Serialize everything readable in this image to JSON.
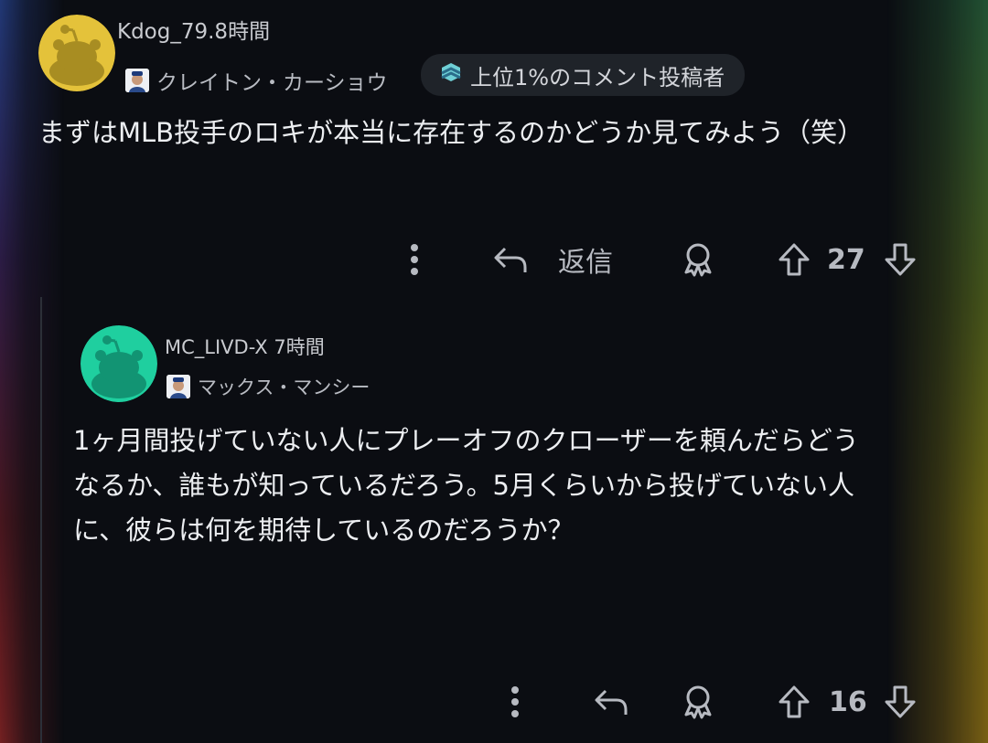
{
  "comments": [
    {
      "username": "Kdog_79",
      "time": ".8時間",
      "flair": "クレイトン・カーショウ",
      "badge": "上位1%のコメント投稿者",
      "body": "まずはMLB投手のロキが本当に存在するのかどうか見てみよう（笑）",
      "reply_label": "返信",
      "votes": "27",
      "avatar_color": "#e4c23a"
    },
    {
      "username": "MC_LIVD-X",
      "time": "7時間",
      "flair": "マックス・マンシー",
      "body": "1ヶ月間投げていない人にプレーオフのクローザーを頼んだらどうなるか、誰もが知っているだろう。5月くらいから投げていない人に、彼らは何を期待しているのだろうか？",
      "votes": "16",
      "avatar_color": "#1fcf9f"
    }
  ],
  "icons": {
    "more": "more-vertical-icon",
    "reply": "reply-arrow-icon",
    "award": "award-icon",
    "upvote": "upvote-arrow-icon",
    "downvote": "downvote-arrow-icon",
    "badge": "top-commenter-icon",
    "avatar": "snoo-avatar-icon",
    "flair": "player-flair-icon"
  }
}
